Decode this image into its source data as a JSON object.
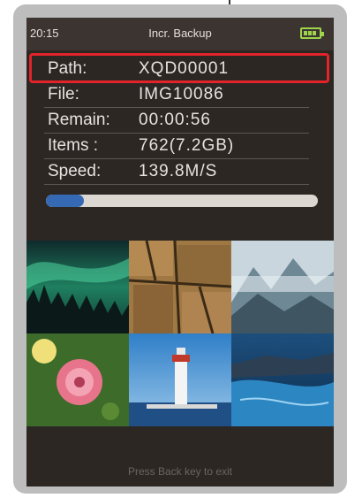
{
  "status_bar": {
    "time": "20:15",
    "title": "Incr. Backup",
    "battery_color": "#9ed34a"
  },
  "info": [
    {
      "label": "Path:",
      "value": "XQD00001"
    },
    {
      "label": "File:",
      "value": "IMG10086"
    },
    {
      "label": "Remain:",
      "value": "00:00:56"
    },
    {
      "label": "Items :",
      "value": "762(7.2GB)"
    },
    {
      "label": "Speed:",
      "value": "139.8M/S"
    }
  ],
  "highlight_color": "#e2232a",
  "progress": {
    "fraction": 0.14,
    "fill_color": "#3569b4"
  },
  "thumbnails": [
    "aurora-forest",
    "cracked-rock",
    "misty-mountains",
    "pink-flower",
    "lighthouse",
    "blue-lake"
  ],
  "footer": {
    "hint": "Press Back key to exit"
  }
}
